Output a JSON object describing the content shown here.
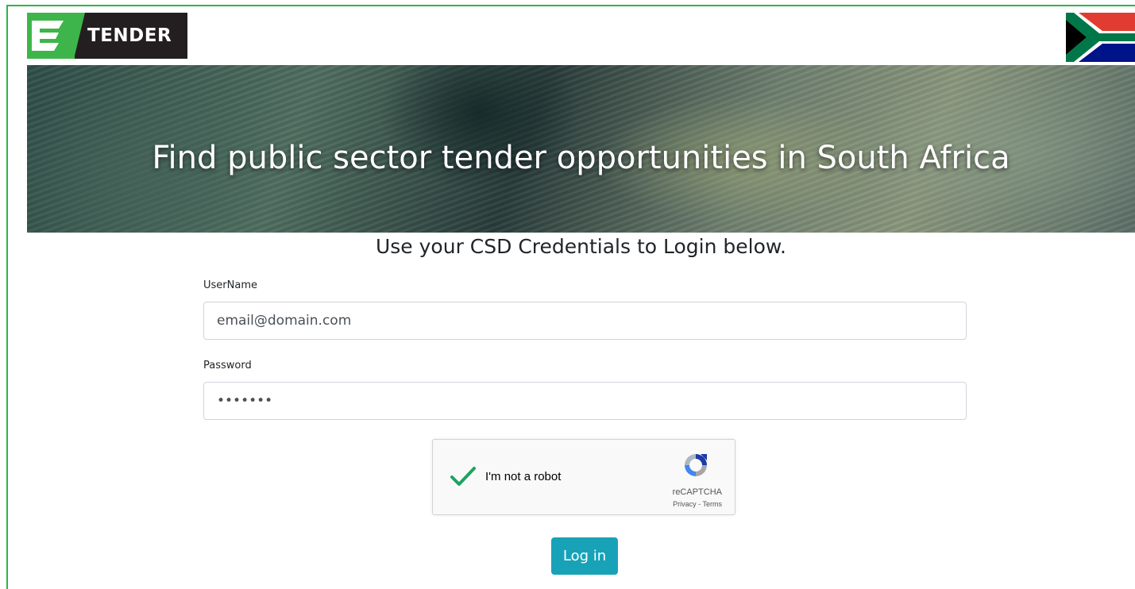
{
  "header": {
    "logo_text": "TENDER",
    "logo_icon": "etender-e-mark",
    "flag_icon": "south-africa-flag-icon"
  },
  "banner": {
    "title": "Find public sector tender opportunities in South Africa"
  },
  "login": {
    "subtitle": "Use your CSD Credentials to Login below.",
    "username_label": "UserName",
    "username_value": "email@domain.com",
    "password_label": "Password",
    "password_value": "•••••••",
    "submit_label": "Log in"
  },
  "recaptcha": {
    "label": "I'm not a robot",
    "brand": "reCAPTCHA",
    "privacy": "Privacy",
    "separator": " - ",
    "terms": "Terms",
    "checked": true
  },
  "colors": {
    "brand_green": "#3eb54a",
    "brand_dark": "#231f20",
    "button": "#17a2b8",
    "frame_border": "#2fb34a"
  }
}
